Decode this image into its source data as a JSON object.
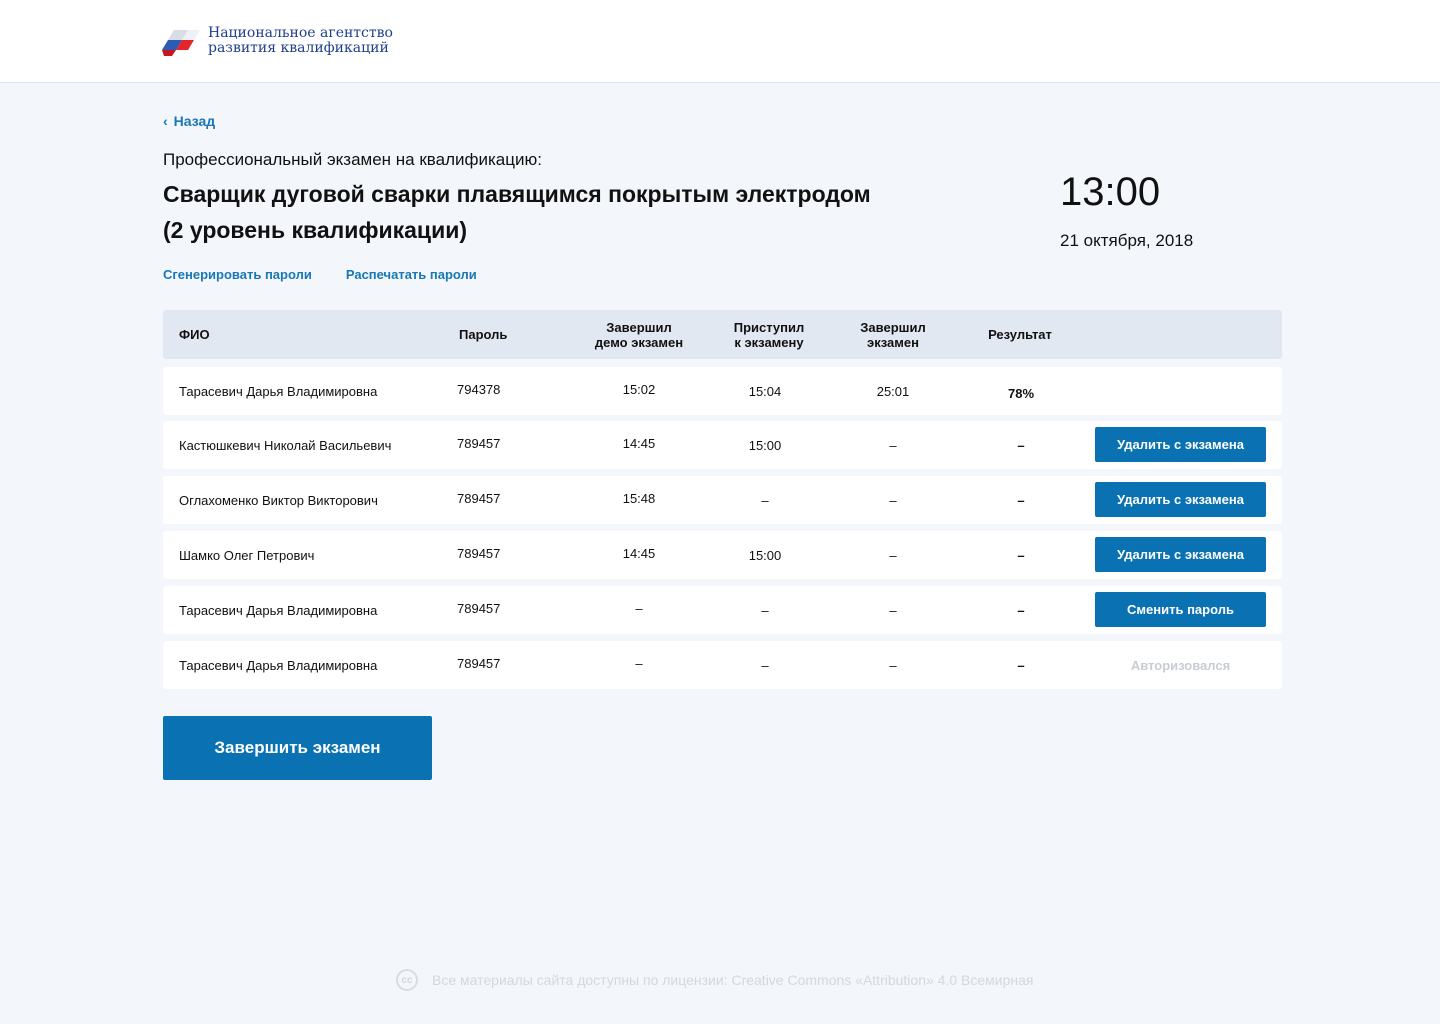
{
  "header": {
    "logo_line1": "Национальное агентство",
    "logo_line2": "развития квалификаций"
  },
  "nav": {
    "back_label": "Назад"
  },
  "exam": {
    "subtitle": "Профессиональный экзамен на квалификацию:",
    "title_line1": "Сварщик дуговой сварки плавящимся покрытым электродом",
    "title_line2": "(2 уровень квалификации)",
    "time": "13:00",
    "date": "21 октября, 2018"
  },
  "links": {
    "generate": "Сгенерировать пароли",
    "print": "Распечатать пароли"
  },
  "table": {
    "headers": {
      "name": "ФИО",
      "password": "Пароль",
      "demo_line1": "Завершил",
      "demo_line2": "демо экзамен",
      "start_line1": "Приступил",
      "start_line2": "к экзамену",
      "end_line1": "Завершил",
      "end_line2": "экзамен",
      "result": "Результат"
    },
    "rows": [
      {
        "name": "Тарасевич Дарья Владимировна",
        "password": "794378",
        "demo": "15:02",
        "start": "15:04",
        "end": "25:01",
        "result": "78%",
        "action": ""
      },
      {
        "name": "Кастюшкевич Николай Васильевич",
        "password": "789457",
        "demo": "14:45",
        "start": "15:00",
        "end": "–",
        "result": "–",
        "action": "Удалить с экзамена"
      },
      {
        "name": "Оглахоменко Виктор Викторович",
        "password": "789457",
        "demo": "15:48",
        "start": "–",
        "end": "–",
        "result": "–",
        "action": "Удалить с экзамена"
      },
      {
        "name": "Шамко Олег Петрович",
        "password": "789457",
        "demo": "14:45",
        "start": "15:00",
        "end": "–",
        "result": "–",
        "action": "Удалить с экзамена"
      },
      {
        "name": "Тарасевич Дарья Владимировна",
        "password": "789457",
        "demo": "–",
        "start": "–",
        "end": "–",
        "result": "–",
        "action": "Сменить пароль"
      },
      {
        "name": "Тарасевич Дарья Владимировна",
        "password": "789457",
        "demo": "–",
        "start": "–",
        "end": "–",
        "result": "–",
        "status": "Авторизовался"
      }
    ]
  },
  "finish_button": "Завершить экзамен",
  "footer": {
    "license_icon": "cc-icon",
    "license_text": "Все материалы сайта доступны по лицензии: Creative Commons «Attribution» 4.0 Всемирная"
  },
  "colors": {
    "accent": "#0a72b3",
    "link": "#1877b4",
    "background": "#f3f6fa",
    "table_header": "#e1e8f1"
  }
}
